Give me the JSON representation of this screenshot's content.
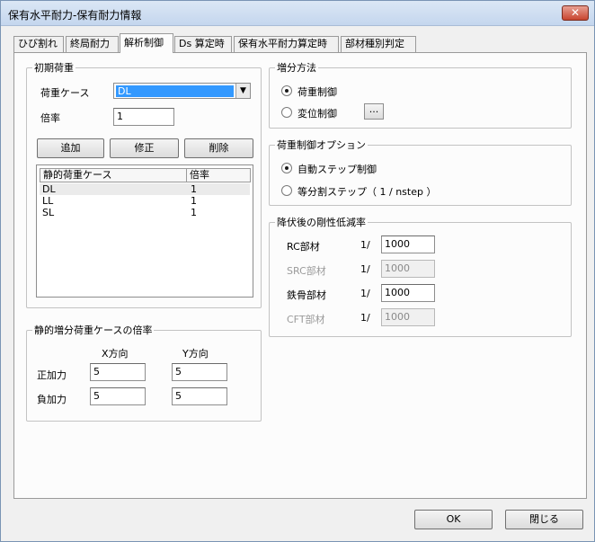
{
  "window": {
    "title": "保有水平耐力-保有耐力情報",
    "close_label": "✕"
  },
  "tabs": [
    {
      "label": "ひび割れ"
    },
    {
      "label": "終局耐力"
    },
    {
      "label": "解析制御"
    },
    {
      "label": "Ds 算定時"
    },
    {
      "label": "保有水平耐力算定時"
    },
    {
      "label": "部材種別判定"
    }
  ],
  "initial_load": {
    "group_label": "初期荷重",
    "case_label": "荷重ケース",
    "case_value": "DL",
    "factor_label": "倍率",
    "factor_value": "1",
    "add_button": "追加",
    "edit_button": "修正",
    "delete_button": "削除",
    "columns": [
      "静的荷重ケース",
      "倍率"
    ],
    "rows": [
      {
        "case": "DL",
        "factor": "1"
      },
      {
        "case": "LL",
        "factor": "1"
      },
      {
        "case": "SL",
        "factor": "1"
      }
    ]
  },
  "incremental": {
    "group_label": "静的増分荷重ケースの倍率",
    "x_header": "X方向",
    "y_header": "Y方向",
    "positive_label": "正加力",
    "negative_label": "負加力",
    "pos_x": "5",
    "pos_y": "5",
    "neg_x": "5",
    "neg_y": "5"
  },
  "increment_method": {
    "group_label": "増分方法",
    "load_control": "荷重制御",
    "disp_control": "変位制御",
    "ellipsis": "...",
    "selected": "load_control"
  },
  "load_control_options": {
    "group_label": "荷重制御オプション",
    "auto_step": "自動ステップ制御",
    "equal_step": "等分割ステップ（ 1 / nstep ）",
    "selected": "auto_step"
  },
  "stiffness_reduction": {
    "group_label": "降伏後の剛性低減率",
    "prefix": "1/",
    "rows": [
      {
        "label": "RC部材",
        "value": "1000",
        "enabled": true
      },
      {
        "label": "SRC部材",
        "value": "1000",
        "enabled": false
      },
      {
        "label": "鉄骨部材",
        "value": "1000",
        "enabled": true
      },
      {
        "label": "CFT部材",
        "value": "1000",
        "enabled": false
      }
    ]
  },
  "footer": {
    "ok_button": "OK",
    "close_button": "閉じる"
  }
}
